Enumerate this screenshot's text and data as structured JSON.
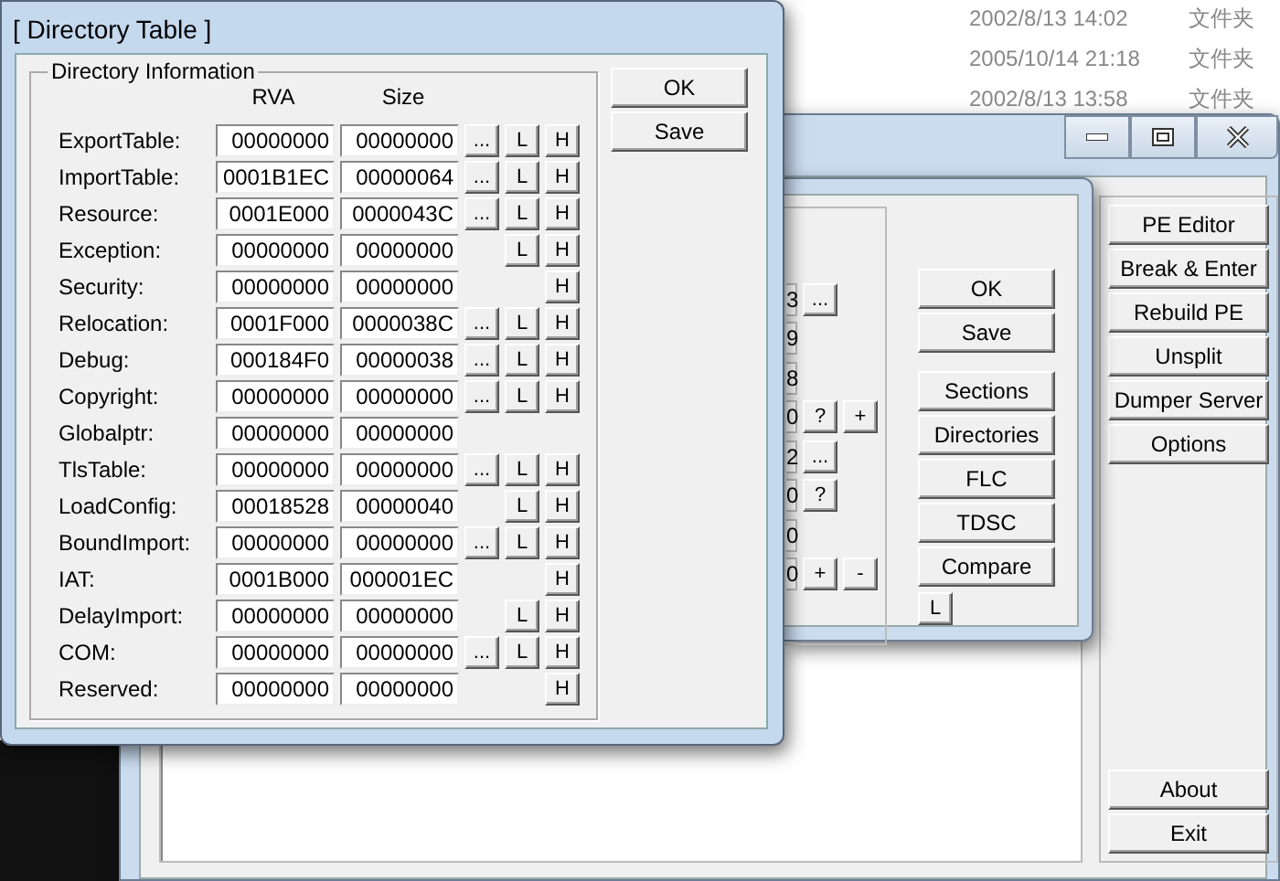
{
  "explorer_rows": [
    {
      "date": "2002/8/13 14:02",
      "type": "文件夹"
    },
    {
      "date": "2005/10/14 21:18",
      "type": "文件夹"
    },
    {
      "date": "2002/8/13 13:58",
      "type": "文件夹"
    }
  ],
  "main_window": {
    "side_buttons": [
      "PE Editor",
      "Break & Enter",
      "Rebuild PE",
      "Unsplit",
      "Dumper Server",
      "Options"
    ],
    "bottom_buttons": [
      "About",
      "Exit"
    ]
  },
  "pe_editor": {
    "rows": [
      {
        "value": "3",
        "buttons": [
          "..."
        ]
      },
      {
        "value": "9",
        "buttons": []
      },
      {
        "value": "8",
        "buttons": []
      },
      {
        "value": "0",
        "buttons": [
          "?",
          "+"
        ]
      },
      {
        "value": "2",
        "buttons": [
          "..."
        ]
      },
      {
        "value": "0",
        "buttons": [
          "?"
        ]
      },
      {
        "value": "0",
        "buttons": []
      },
      {
        "value": "0",
        "buttons": [
          "+",
          "-"
        ]
      }
    ],
    "top_buttons": [
      "OK",
      "Save"
    ],
    "tool_buttons": [
      "Sections",
      "Directories",
      "FLC",
      "TDSC",
      "Compare"
    ],
    "small_button": "L"
  },
  "directory_table": {
    "title": "[ Directory Table ]",
    "group_title": "Directory Information",
    "columns": [
      "RVA",
      "Size"
    ],
    "buttons": [
      "OK",
      "Save"
    ],
    "rows": [
      {
        "label": "ExportTable:",
        "rva": "00000000",
        "size": "00000000",
        "dots_button": "...",
        "l_button": "L",
        "h_button": "H"
      },
      {
        "label": "ImportTable:",
        "rva": "0001B1EC",
        "size": "00000064",
        "dots_button": "...",
        "l_button": "L",
        "h_button": "H"
      },
      {
        "label": "Resource:",
        "rva": "0001E000",
        "size": "0000043C",
        "dots_button": "...",
        "l_button": "L",
        "h_button": "H"
      },
      {
        "label": "Exception:",
        "rva": "00000000",
        "size": "00000000",
        "l_button": "L",
        "h_button": "H"
      },
      {
        "label": "Security:",
        "rva": "00000000",
        "size": "00000000",
        "h_button": "H"
      },
      {
        "label": "Relocation:",
        "rva": "0001F000",
        "size": "0000038C",
        "dots_button": "...",
        "l_button": "L",
        "h_button": "H"
      },
      {
        "label": "Debug:",
        "rva": "000184F0",
        "size": "00000038",
        "dots_button": "...",
        "l_button": "L",
        "h_button": "H"
      },
      {
        "label": "Copyright:",
        "rva": "00000000",
        "size": "00000000",
        "dots_button": "...",
        "l_button": "L",
        "h_button": "H"
      },
      {
        "label": "Globalptr:",
        "rva": "00000000",
        "size": "00000000"
      },
      {
        "label": "TlsTable:",
        "rva": "00000000",
        "size": "00000000",
        "dots_button": "...",
        "l_button": "L",
        "h_button": "H"
      },
      {
        "label": "LoadConfig:",
        "rva": "00018528",
        "size": "00000040",
        "l_button": "L",
        "h_button": "H"
      },
      {
        "label": "BoundImport:",
        "rva": "00000000",
        "size": "00000000",
        "dots_button": "...",
        "l_button": "L",
        "h_button": "H"
      },
      {
        "label": "IAT:",
        "rva": "0001B000",
        "size": "000001EC",
        "h_button": "H"
      },
      {
        "label": "DelayImport:",
        "rva": "00000000",
        "size": "00000000",
        "l_button": "L",
        "h_button": "H"
      },
      {
        "label": "COM:",
        "rva": "00000000",
        "size": "00000000",
        "dots_button": "...",
        "l_button": "L",
        "h_button": "H"
      },
      {
        "label": "Reserved:",
        "rva": "00000000",
        "size": "00000000",
        "h_button": "H"
      }
    ]
  }
}
